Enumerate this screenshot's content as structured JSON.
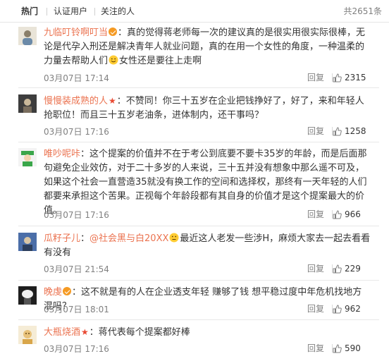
{
  "tabs": [
    "热门",
    "认证用户",
    "关注的人"
  ],
  "total": "共2651条",
  "reply_label": "回复",
  "colors": {
    "username": "#eb7350",
    "muted": "#808080",
    "text": "#333333"
  },
  "comments": [
    {
      "user": "九临叮铃啊叮当",
      "badge": "vip",
      "text_a": "：真的觉得蒋老师每一次的建议真的是很实用很实际很棒，无论是代孕入刑还是解决青年人就业问题，真的在用一个女性的角度，一种温柔的力量去帮助人们",
      "emoji": "smile-emoji",
      "text_b": "女性还是要往上走啊",
      "time": "03月07日 17:14",
      "likes": "2315"
    },
    {
      "user": "慢慢装成熟的人",
      "badge": "star",
      "text_a": "：不赞同！你三十五岁在企业把钱挣好了，好了，来和年轻人抢职位！而且三十五岁老油条，进体制内，还干事吗？",
      "time": "03月07日 17:16",
      "likes": "1258"
    },
    {
      "user": "唯吵呢咔",
      "badge": "",
      "text_a": "：这个提案的价值并不在于考公到底要不要卡35岁的年龄，而是后面那句避免企业效仿，对于二十多岁的人来说，三十五并没有想象中那么遥不可及，如果这个社会一直营造35就没有换工作的空间和选择权，那终有一天年轻的人们都要来承担这个苦果。正视每个年龄段都有其自身的价值才是这个提案最大的价值。",
      "time": "03月07日 17:16",
      "likes": "966"
    },
    {
      "user": "瓜籽子儿",
      "badge": "",
      "mention": "@社会黑与白20XX",
      "text_a": "：",
      "text_b": "最近这人老发一些涉H，麻烦大家去一起去看看有没有",
      "time": "03月07日 21:54",
      "likes": "229"
    },
    {
      "user": "晚虔",
      "badge": "vip",
      "text_a": "：这不就是有的人在企业透支年轻 赚够了钱 想平稳过度中年危机找地方混吗？",
      "time": "03月07日 18:01",
      "likes": "962"
    },
    {
      "user": "大瓶烧酒",
      "badge": "star",
      "text_a": "：蒋代表每个提案都好棒",
      "time": "03月07日 17:16",
      "likes": "590"
    }
  ]
}
